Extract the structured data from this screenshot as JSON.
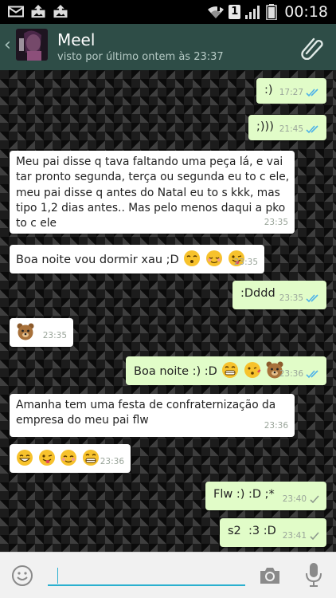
{
  "status_bar": {
    "time": "00:18",
    "sim_label": "1",
    "icons": [
      "mail-icon",
      "image-upload-icon",
      "image-upload-icon",
      "wifi-icon",
      "signal-icon",
      "battery-icon"
    ]
  },
  "header": {
    "contact_name": "Meel",
    "last_seen": "visto por último ontem às 23:37",
    "icons": [
      "back-chevron-icon",
      "avatar",
      "paperclip-icon"
    ]
  },
  "messages": [
    {
      "dir": "out",
      "text": ":)",
      "time": "17:27",
      "status": "read",
      "emoji": []
    },
    {
      "dir": "out",
      "text": ";)))",
      "time": "21:45",
      "status": "read",
      "emoji": []
    },
    {
      "dir": "in",
      "text": "Meu pai disse q tava faltando uma peça lá, e vai tar pronto segunda, terça ou segunda eu to c ele, meu pai disse q antes do Natal eu to s kkk, mas tipo 1,2 dias antes.. Mas pelo menos daqui a pko to c ele",
      "time": "23:35",
      "emoji": []
    },
    {
      "dir": "in",
      "text": "Boa noite vou dormir xau ;D",
      "time": "23:35",
      "emoji": [
        "kissing-closed-eyes",
        "relieved-face",
        "winking-tongue-face"
      ]
    },
    {
      "dir": "out",
      "text": ":Dddd",
      "time": "23:35",
      "status": "read",
      "emoji": []
    },
    {
      "dir": "in",
      "text": "",
      "time": "23:35",
      "emoji": [
        "bear-face"
      ]
    },
    {
      "dir": "out",
      "text": "Boa noite :) :D",
      "time": "23:36",
      "status": "read",
      "emoji": [
        "grinning-teeth-face",
        "kiss-heart-face",
        "bear-face"
      ]
    },
    {
      "dir": "in",
      "text": "Amanha tem uma festa de confraternização da empresa do meu pai flw",
      "time": "23:36",
      "emoji": []
    },
    {
      "dir": "in",
      "text": "",
      "time": "23:36",
      "emoji": [
        "smile-face",
        "winking-tongue-face",
        "blush-face",
        "grinning-teeth-face"
      ]
    },
    {
      "dir": "out",
      "text": "Flw :) :D ;*",
      "time": "23:40",
      "status": "sent",
      "emoji": []
    },
    {
      "dir": "out",
      "text": "s2  :3 :D",
      "time": "23:41",
      "status": "sent",
      "emoji": []
    }
  ],
  "input_bar": {
    "placeholder": "",
    "value": "",
    "icons": [
      "smiley-icon",
      "camera-icon",
      "microphone-icon"
    ]
  },
  "colors": {
    "header_bg": "#2e4d47",
    "outgoing_bubble": "#e1fcc8",
    "incoming_bubble": "#ffffff",
    "read_tick": "#4fb3e8",
    "sent_tick": "#8e9a8e",
    "input_underline": "#2bb0cf"
  }
}
